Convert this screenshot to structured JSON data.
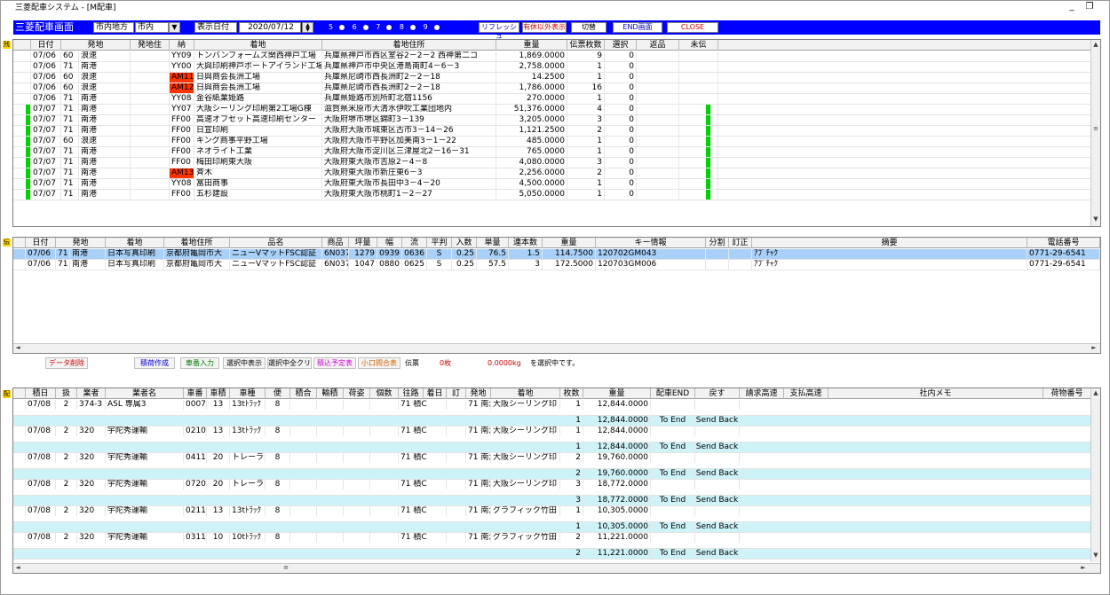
{
  "window": {
    "title": "三菱配車システム - [M配車]",
    "min_label": "_",
    "restore_label": "❐"
  },
  "toolbar": {
    "screen_title": "三菱配車画面",
    "area_label": "市内地方",
    "area_value": "市内",
    "date_label": "表示日付",
    "date_value": "2020/07/12",
    "radios": [
      "5",
      "6",
      "7",
      "8",
      "9"
    ],
    "radio_suffixes": [
      "5○",
      "6○",
      "7○",
      "8○",
      "9○"
    ],
    "refresh_label": "リフレッシュ",
    "unset_label": "有休以外表示",
    "switch_label": "切替",
    "end_label": "END画面",
    "close_label": "CLOSE"
  },
  "top_grid": {
    "tag": "残",
    "headers": [
      "日付",
      "発地",
      "発地住",
      "納",
      "着地",
      "着地住所",
      "重量",
      "伝票枚数",
      "選択",
      "返品",
      "未伝"
    ],
    "rows": [
      {
        "date": "07/06",
        "code": "60",
        "orig": "浪速",
        "cd": "YY09",
        "dest": "トンバンフォームズ関西神戸工場",
        "addr": "兵庫県神戸市西区室谷2－2－2 西神第二コ",
        "weight": "1,869.0000",
        "cnt": "9",
        "sel": "0",
        "mark": "",
        "green": false,
        "greenR": false
      },
      {
        "date": "07/06",
        "code": "71",
        "orig": "南港",
        "cd": "YY00",
        "dest": "大與印刷神戸ポートアイランド工場",
        "addr": "兵庫県神戸市中央区港島南町4－6－3",
        "weight": "2,758.0000",
        "cnt": "1",
        "sel": "0",
        "mark": "",
        "green": false,
        "greenR": false
      },
      {
        "date": "07/06",
        "code": "60",
        "orig": "浪速",
        "cd": "AM11",
        "dest": "日與商会長洲工場",
        "addr": "兵庫県尼崎市西長洲町2－2－18",
        "weight": "14.2500",
        "cnt": "1",
        "sel": "0",
        "mark": "red",
        "green": false,
        "greenR": false
      },
      {
        "date": "07/06",
        "code": "60",
        "orig": "浪速",
        "cd": "AM12",
        "dest": "日與商会長洲工場",
        "addr": "兵庫県尼崎市西長洲町2－2－18",
        "weight": "1,786.0000",
        "cnt": "16",
        "sel": "0",
        "mark": "red",
        "green": false,
        "greenR": false
      },
      {
        "date": "07/06",
        "code": "71",
        "orig": "南港",
        "cd": "YY08",
        "dest": "金谷紙業姫路",
        "addr": "兵庫県姫路市別所町北宿1156",
        "weight": "270.0000",
        "cnt": "1",
        "sel": "0",
        "mark": "",
        "green": false,
        "greenR": false
      },
      {
        "date": "07/07",
        "code": "71",
        "orig": "南港",
        "cd": "YY07",
        "dest": "大阪シーリング印刷第2工場G棟",
        "addr": "滋賀県米原市大清水伊吹工業団地内",
        "weight": "51,376.0000",
        "cnt": "4",
        "sel": "0",
        "mark": "",
        "green": true,
        "greenR": true
      },
      {
        "date": "07/07",
        "code": "71",
        "orig": "南港",
        "cd": "FF00",
        "dest": "高速オフセット高速印刷センター",
        "addr": "大阪府堺市堺区錦町3－139",
        "weight": "3,205.0000",
        "cnt": "3",
        "sel": "0",
        "mark": "",
        "green": true,
        "greenR": true
      },
      {
        "date": "07/07",
        "code": "71",
        "orig": "南港",
        "cd": "FF00",
        "dest": "日宣印刷",
        "addr": "大阪府大阪市城東区古市3－14－26",
        "weight": "1,121.2500",
        "cnt": "2",
        "sel": "0",
        "mark": "",
        "green": true,
        "greenR": true
      },
      {
        "date": "07/07",
        "code": "60",
        "orig": "浪速",
        "cd": "FF00",
        "dest": "キング商事平野工場",
        "addr": "大阪府大阪市平野区加美南3－1－22",
        "weight": "485.0000",
        "cnt": "1",
        "sel": "0",
        "mark": "",
        "green": true,
        "greenR": true
      },
      {
        "date": "07/07",
        "code": "71",
        "orig": "南港",
        "cd": "FF00",
        "dest": "ネオライト工業",
        "addr": "大阪府大阪市淀川区三津屋北2－16－31",
        "weight": "765.0000",
        "cnt": "1",
        "sel": "0",
        "mark": "",
        "green": true,
        "greenR": true
      },
      {
        "date": "07/07",
        "code": "71",
        "orig": "南港",
        "cd": "FF00",
        "dest": "梅田印刷東大阪",
        "addr": "大阪府東大阪市吉原2－4－8",
        "weight": "4,080.0000",
        "cnt": "3",
        "sel": "0",
        "mark": "",
        "green": true,
        "greenR": true
      },
      {
        "date": "07/07",
        "code": "71",
        "orig": "南港",
        "cd": "AM13",
        "dest": "斉木",
        "addr": "大阪府東大阪市新庄東6－3",
        "weight": "2,256.0000",
        "cnt": "2",
        "sel": "0",
        "mark": "red",
        "green": true,
        "greenR": true
      },
      {
        "date": "07/07",
        "code": "71",
        "orig": "南港",
        "cd": "YY08",
        "dest": "富田商事",
        "addr": "大阪府東大阪市長田中3－4－20",
        "weight": "4,500.0000",
        "cnt": "1",
        "sel": "0",
        "mark": "",
        "green": true,
        "greenR": true
      },
      {
        "date": "07/07",
        "code": "71",
        "orig": "南港",
        "cd": "FF00",
        "dest": "五杉建設",
        "addr": "大阪府東大阪市桃町1－2－27",
        "weight": "5,050.0000",
        "cnt": "1",
        "sel": "0",
        "mark": "",
        "green": true,
        "greenR": true
      }
    ]
  },
  "mid_grid": {
    "tag": "伝",
    "headers": [
      "日付",
      "発地",
      "着地",
      "着地住所",
      "品名",
      "商品",
      "坪量",
      "幅",
      "流",
      "平判",
      "入数",
      "単量",
      "連本数",
      "重量",
      "キー情報",
      "分割",
      "訂正",
      "摘要",
      "電話番号"
    ],
    "rows": [
      {
        "date": "07/06",
        "code": "71",
        "orig": "南港",
        "dest": "日本写真印刷",
        "addr": "京都府亀岡市大",
        "item": "ニューVマットFSC認証",
        "prod": "6N037",
        "tsubo": "1279",
        "haba": "0939",
        "nagare": "0636",
        "flat": "S",
        "iri": "0.25",
        "unit": "76.5",
        "ren": "1.5",
        "weight": "114.7500",
        "key": "120702GM043",
        "memo": "ｱﾌﾞﾁｬｸ",
        "tel": "0771-29-6541",
        "selected": true
      },
      {
        "date": "07/06",
        "code": "71",
        "orig": "南港",
        "dest": "日本写真印刷",
        "addr": "京都府亀岡市大",
        "item": "ニューVマットFSC認証",
        "prod": "6N037",
        "tsubo": "1047",
        "haba": "0880",
        "nagare": "0625",
        "flat": "S",
        "iri": "0.25",
        "unit": "57.5",
        "ren": "3",
        "weight": "172.5000",
        "key": "120703GM006",
        "memo": "ｱﾌﾞﾁｬｸ",
        "tel": "0771-29-6541",
        "selected": false
      }
    ]
  },
  "actions": {
    "delete_label": "データ削除",
    "loading_label": "積荷作成",
    "input_label": "車番入力",
    "selected_show_label": "選択中表示",
    "select_all_label": "選択中全クリ",
    "plan_label": "積込予定表",
    "small_label": "小口問合表",
    "slip_label": "伝票",
    "slip_count": "0枚",
    "weight_value": "0.0000kg",
    "status_text": "を選択中です。"
  },
  "bottom_grid": {
    "tag": "配",
    "headers": [
      "積日",
      "扱",
      "業者",
      "業者名",
      "車番",
      "車積",
      "車種",
      "便",
      "積合",
      "輸積",
      "荷姿",
      "個数",
      "往路",
      "着日",
      "訂",
      "発地",
      "着地",
      "枚数",
      "重量",
      "配車END",
      "戻す",
      "請求高速",
      "支払高速",
      "社内メモ",
      "荷物番号"
    ],
    "to_end": "To End",
    "send_back": "Send Back",
    "rows": [
      {
        "date": "07/08",
        "kind": "2",
        "vendor": "374-3",
        "vname": "ASL 専属3",
        "car": "0007",
        "load": "13",
        "ctype": "13tﾄﾗｯｸ",
        "trip": "8",
        "route": "71 積C",
        "orig": "71 南港",
        "dest": "大阪シーリング印",
        "cnt": "1",
        "weight": "12,844.0000",
        "cnt2": "1",
        "weight2": "12,844.0000"
      },
      {
        "date": "07/08",
        "kind": "2",
        "vendor": "320",
        "vname": "宇陀秀運輸",
        "car": "0210",
        "load": "13",
        "ctype": "13tﾄﾗｯｸ",
        "trip": "8",
        "route": "71 積C",
        "orig": "71 南港",
        "dest": "大阪シーリング印",
        "cnt": "1",
        "weight": "12,844.0000",
        "cnt2": "1",
        "weight2": "12,844.0000"
      },
      {
        "date": "07/08",
        "kind": "2",
        "vendor": "320",
        "vname": "宇陀秀運輸",
        "car": "0411",
        "load": "20",
        "ctype": "トレーラ",
        "trip": "8",
        "route": "71 積C",
        "orig": "71 南港",
        "dest": "大阪シーリング印",
        "cnt": "2",
        "weight": "19,760.0000",
        "cnt2": "2",
        "weight2": "19,760.0000"
      },
      {
        "date": "07/08",
        "kind": "2",
        "vendor": "320",
        "vname": "宇陀秀運輸",
        "car": "0720",
        "load": "20",
        "ctype": "トレーラ",
        "trip": "8",
        "route": "71 積C",
        "orig": "71 南港",
        "dest": "大阪シーリング印",
        "cnt": "3",
        "weight": "18,772.0000",
        "cnt2": "3",
        "weight2": "18,772.0000"
      },
      {
        "date": "07/08",
        "kind": "2",
        "vendor": "320",
        "vname": "宇陀秀運輸",
        "car": "0211",
        "load": "13",
        "ctype": "13tﾄﾗｯｸ",
        "trip": "8",
        "route": "71 積C",
        "orig": "71 南港",
        "dest": "グラフィック竹田",
        "cnt": "1",
        "weight": "10,305.0000",
        "cnt2": "1",
        "weight2": "10,305.0000"
      },
      {
        "date": "07/08",
        "kind": "2",
        "vendor": "320",
        "vname": "宇陀秀運輸",
        "car": "0311",
        "load": "10",
        "ctype": "10tﾄﾗｯｸ",
        "trip": "8",
        "route": "71 積C",
        "orig": "71 南港",
        "dest": "グラフィック竹田",
        "cnt": "2",
        "weight": "11,221.0000",
        "cnt2": "2",
        "weight2": "11,221.0000"
      }
    ]
  },
  "colors": {
    "toolbar_bg": "#0000ff",
    "alert_red": "#ff3300",
    "green_flag": "#00d400",
    "selected_row": "#a8d0f8",
    "alt_row": "#cdf3f8"
  }
}
